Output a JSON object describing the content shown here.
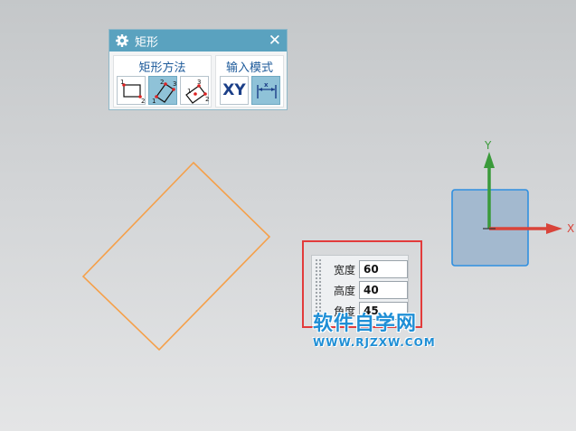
{
  "dialog": {
    "title": "矩形",
    "close_glyph": "✕",
    "method_group_label": "矩形方法",
    "input_mode_group_label": "输入模式",
    "method_buttons": [
      {
        "name": "two-point-rectangle-icon",
        "active": false
      },
      {
        "name": "three-point-rectangle-icon",
        "active": true
      },
      {
        "name": "center-rectangle-icon",
        "active": false
      }
    ],
    "input_mode_buttons": [
      {
        "name": "xy-mode-icon",
        "label": "XY",
        "active": false
      },
      {
        "name": "parameter-mode-icon",
        "active": true
      }
    ]
  },
  "triad": {
    "x_label": "X",
    "y_label": "Y"
  },
  "input_panel": {
    "width_label": "宽度",
    "width_value": "60",
    "height_label": "高度",
    "height_value": "40",
    "angle_label": "角度",
    "angle_value": "45"
  },
  "watermark": {
    "title": "软件自学网",
    "url": "WWW.RJZXW.COM"
  },
  "colors": {
    "sketch_stroke": "#f5a04a",
    "dialog_title_bg": "#5aa2bf",
    "highlight": "#e23b3b",
    "y_axis": "#3a9a3a",
    "x_axis": "#d9443a",
    "watermark": "#1f8fd6"
  }
}
